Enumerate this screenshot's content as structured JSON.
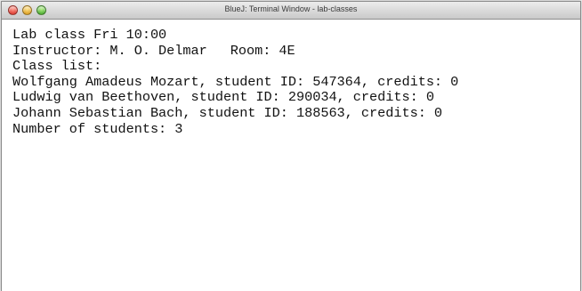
{
  "window": {
    "title": "BlueJ: Terminal Window - lab-classes"
  },
  "terminal": {
    "line1": "Lab class Fri 10:00",
    "instructor": "Instructor: M. O. Delmar",
    "room": "Room: 4E",
    "class_list_header": "Class list:",
    "students": [
      "Wolfgang Amadeus Mozart, student ID: 547364, credits: 0",
      "Ludwig van Beethoven, student ID: 290034, credits: 0",
      "Johann Sebastian Bach, student ID: 188563, credits: 0"
    ],
    "count": "Number of students: 3"
  }
}
